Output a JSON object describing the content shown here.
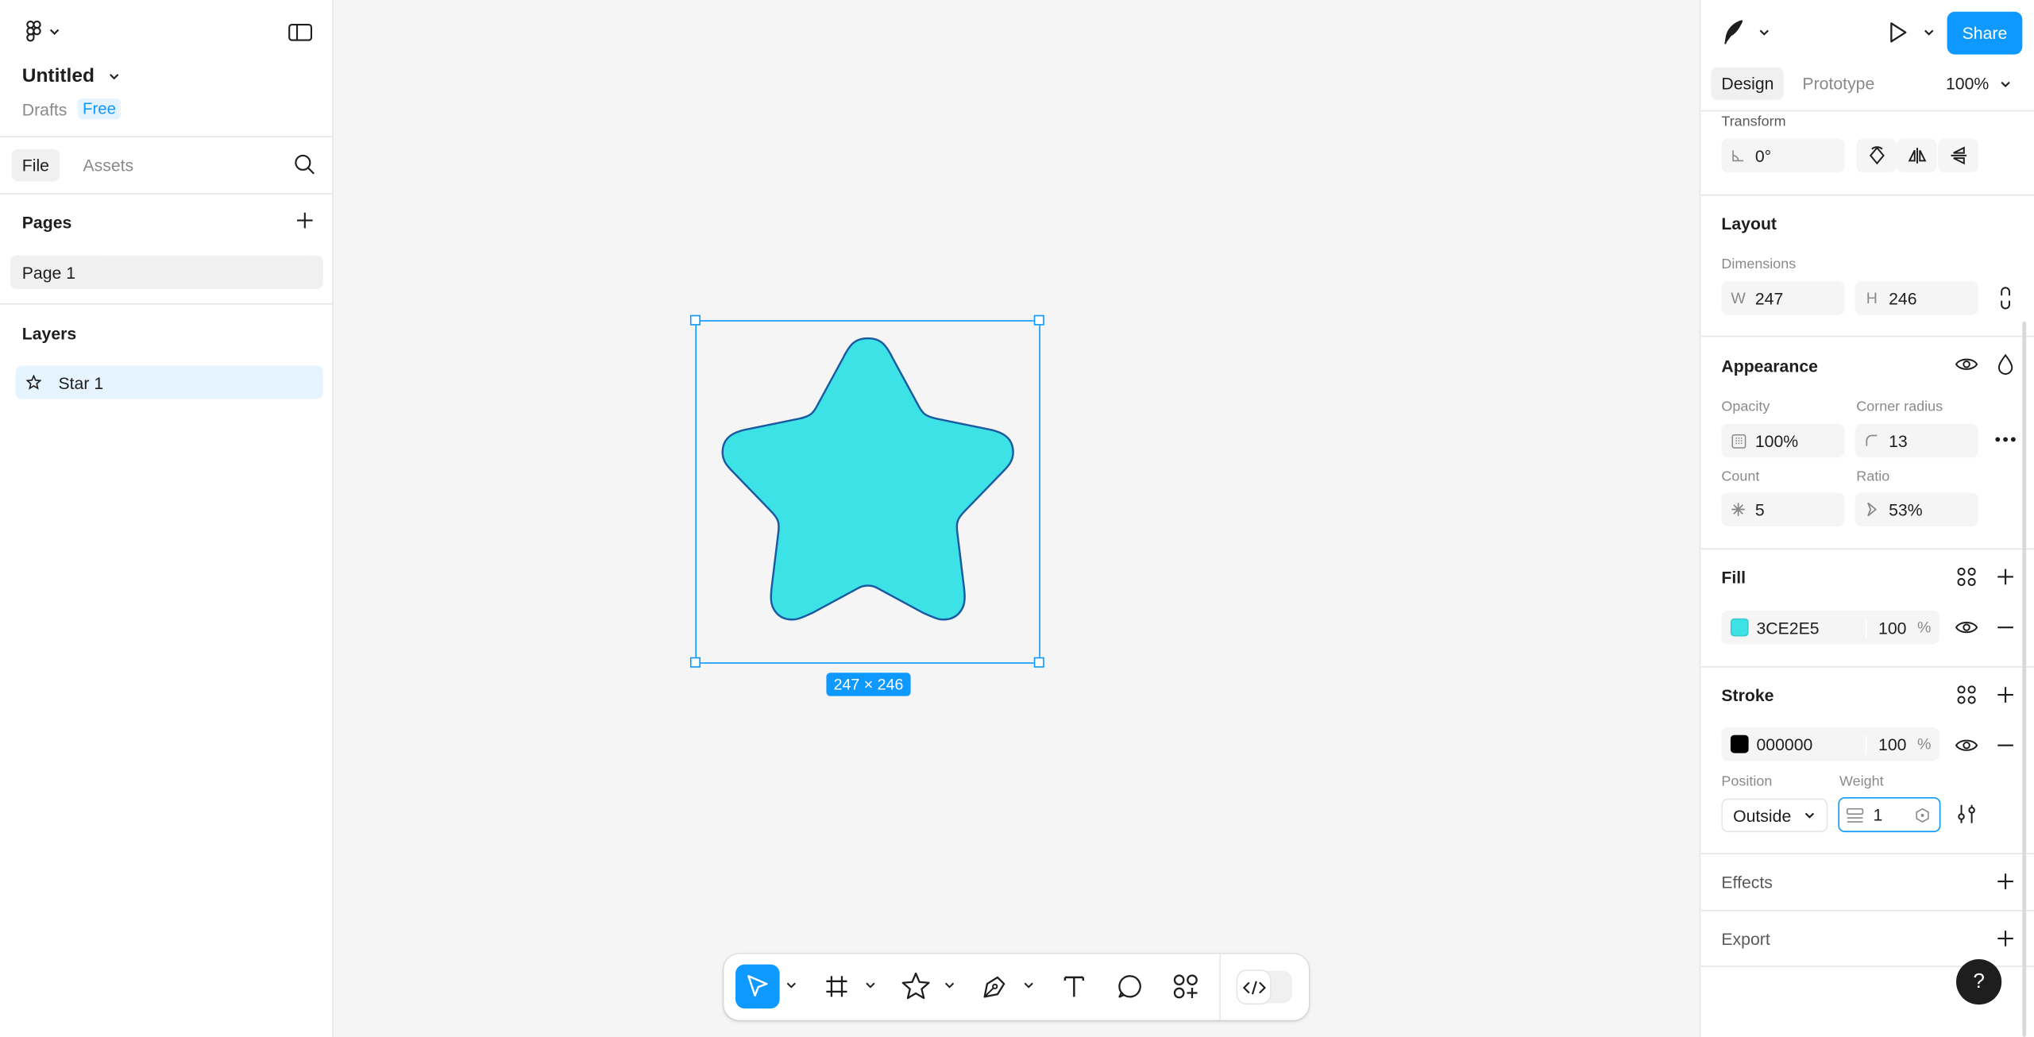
{
  "file": {
    "title": "Untitled",
    "location": "Drafts",
    "plan_badge": "Free"
  },
  "left_tabs": {
    "file": "File",
    "assets": "Assets"
  },
  "pages": {
    "title": "Pages",
    "items": [
      "Page 1"
    ]
  },
  "layers": {
    "title": "Layers",
    "items": [
      "Star 1"
    ]
  },
  "canvas": {
    "selection_size": "247 × 246",
    "star_fill": "#3CE2E5",
    "star_stroke": "#1a5aa0",
    "selection_color": "#0D99FF"
  },
  "header": {
    "share": "Share"
  },
  "right_tabs": {
    "design": "Design",
    "prototype": "Prototype",
    "zoom": "100%"
  },
  "transform": {
    "title": "Transform",
    "rotation": "0°"
  },
  "layout": {
    "title": "Layout",
    "dimensions_label": "Dimensions",
    "w_prefix": "W",
    "w": "247",
    "h_prefix": "H",
    "h": "246"
  },
  "appearance": {
    "title": "Appearance",
    "opacity_label": "Opacity",
    "opacity": "100%",
    "corner_label": "Corner radius",
    "corner": "13",
    "count_label": "Count",
    "count": "5",
    "ratio_label": "Ratio",
    "ratio": "53%"
  },
  "fill": {
    "title": "Fill",
    "hex": "3CE2E5",
    "opacity": "100",
    "unit": "%"
  },
  "stroke": {
    "title": "Stroke",
    "hex": "000000",
    "opacity": "100",
    "unit": "%",
    "position_label": "Position",
    "position": "Outside",
    "weight_label": "Weight",
    "weight": "1"
  },
  "effects": {
    "title": "Effects"
  },
  "export": {
    "title": "Export"
  },
  "help": "?"
}
